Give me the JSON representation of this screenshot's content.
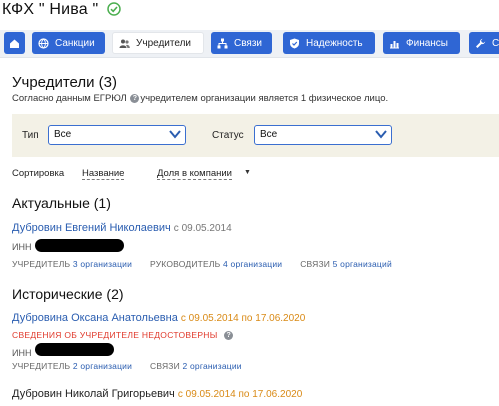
{
  "company": {
    "title": "КФХ \" Нива \""
  },
  "tabs": [
    {
      "label": "",
      "icon": "home-icon"
    },
    {
      "label": "Санкции",
      "icon": "globe-icon"
    },
    {
      "label": "Учредители",
      "icon": "people-icon",
      "active": true
    },
    {
      "label": "Связи",
      "icon": "network-icon"
    },
    {
      "label": "Надежность",
      "icon": "shield-icon"
    },
    {
      "label": "Финансы",
      "icon": "chart-icon"
    },
    {
      "label": "С",
      "icon": "wrench-icon"
    }
  ],
  "founders": {
    "title": "Учредители (3)",
    "subtitle_pre": "Согласно данным ЕГРЮЛ ",
    "subtitle_post": "учредителем организации является 1 физическое лицо."
  },
  "filters": {
    "type_label": "Тип",
    "type_value": "Все",
    "status_label": "Статус",
    "status_value": "Все"
  },
  "sort": {
    "label": "Сортировка",
    "by_name": "Название",
    "by_share": "Доля в компании"
  },
  "actual": {
    "title": "Актуальные (1)",
    "name": "Дубровин Евгений Николаевич",
    "since": "с 09.05.2014",
    "inn_label": "ИНН",
    "role1_label": "УЧРЕДИТЕЛЬ",
    "role1_link": "3 организации",
    "role2_label": "РУКОВОДИТЕЛЬ",
    "role2_link": "4 организации",
    "role3_label": "СВЯЗИ",
    "role3_link": "5 организаций"
  },
  "historical": {
    "title": "Исторические (2)",
    "p1": {
      "name": "Дубровина Оксана Анатольевна",
      "period": "с 09.05.2014 по 17.06.2020",
      "warning": "СВЕДЕНИЯ ОБ УЧРЕДИТЕЛЕ НЕДОСТОВЕРНЫ",
      "inn_label": "ИНН",
      "role1_label": "УЧРЕДИТЕЛЬ",
      "role1_link": "2 организации",
      "role2_label": "СВЯЗИ",
      "role2_link": "2 организации"
    },
    "p2": {
      "name": "Дубровин Николай Григорьевич",
      "period": "с 09.05.2014 по 17.06.2020"
    }
  },
  "colors": {
    "tab_blue": "#2f66d4",
    "link_blue": "#2a5db0",
    "orange": "#d98a16",
    "warn_red": "#e0392b",
    "check_green": "#4caf50",
    "filter_bg": "#f3f1e6"
  }
}
